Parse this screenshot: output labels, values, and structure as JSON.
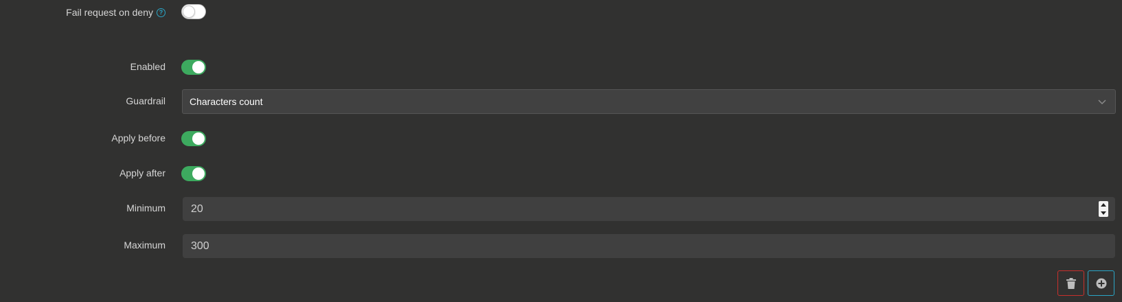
{
  "form": {
    "fail_request_on_deny": {
      "label": "Fail request on deny",
      "help_icon": "question-circle-icon",
      "value": false
    },
    "enabled": {
      "label": "Enabled",
      "value": true
    },
    "guardrail": {
      "label": "Guardrail",
      "selected": "Characters count"
    },
    "apply_before": {
      "label": "Apply before",
      "value": true
    },
    "apply_after": {
      "label": "Apply after",
      "value": true
    },
    "minimum": {
      "label": "Minimum",
      "value": "20"
    },
    "maximum": {
      "label": "Maximum",
      "value": "300"
    }
  },
  "actions": {
    "delete_icon": "trash-icon",
    "add_icon": "plus-circle-icon"
  },
  "colors": {
    "background": "#313130",
    "toggle_on": "#3daa5f",
    "help_accent": "#2aa6c7",
    "delete_border": "#c9302c",
    "add_border": "#2aa6c7"
  }
}
